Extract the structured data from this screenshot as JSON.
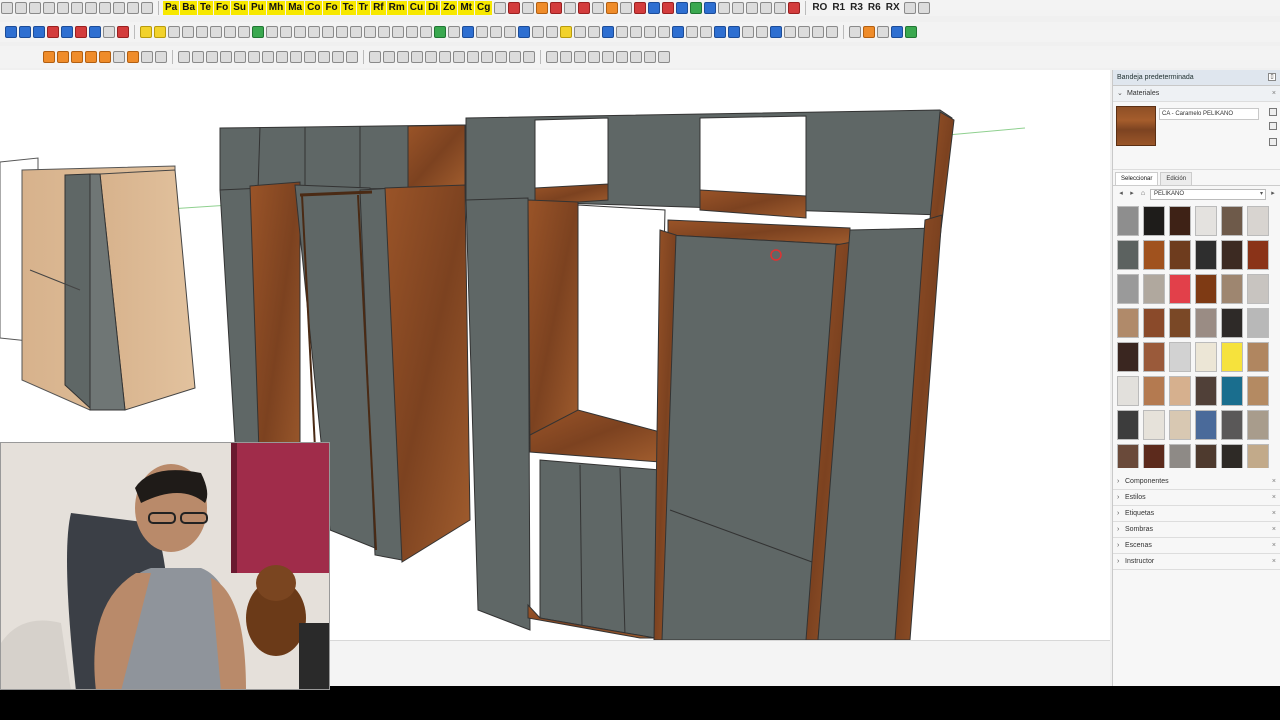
{
  "toolbar": {
    "letter_buttons_left": [
      "Pa",
      "Ba",
      "Te",
      "Fo",
      "Su",
      "Pu",
      "Mh",
      "Ma",
      "Co",
      "Fo",
      "Tc",
      "Tr",
      "Rf",
      "Rm",
      "Cu",
      "Di",
      "Zo",
      "Mt",
      "Cg"
    ],
    "letter_buttons_right": [
      "RO",
      "R1",
      "R3",
      "R6",
      "RX"
    ]
  },
  "tray": {
    "title": "Bandeja predeterminada",
    "materials": {
      "header": "Materiales",
      "current_material": "CA - Caramelo PELIKANO",
      "tabs": [
        "Seleccionar",
        "Edición"
      ],
      "library": "PELIKANO",
      "swatches": [
        "#8e8e8e",
        "#1e1c1a",
        "#3e2216",
        "#e4e2df",
        "#6e5a4a",
        "#d8d4d0",
        "#5c6260",
        "#a0521e",
        "#6e3c1e",
        "#2e2e2e",
        "#3c2a22",
        "#8a3318",
        "#9a9a9a",
        "#b0a89e",
        "#e2404a",
        "#7e3a14",
        "#9e8670",
        "#c8c4c0",
        "#b08a6a",
        "#8a4a2a",
        "#7a4826",
        "#9a8c84",
        "#2e2a28",
        "#b8b8b8",
        "#3a2620",
        "#9a5a3a",
        "#d2d2d2",
        "#ece6d6",
        "#f6e23c",
        "#b08660",
        "#e2e0dc",
        "#b47a50",
        "#d6b08e",
        "#504038",
        "#1a6e8e",
        "#b48a62",
        "#3c3c3c",
        "#e6e2da",
        "#d8c8b2",
        "#4a6a9a",
        "#5a5858",
        "#a89c8c",
        "#6a4a3a",
        "#5c2a1c",
        "#8e8a86",
        "#4e3a2e",
        "#2e2a26",
        "#c2aa8a"
      ]
    },
    "sections": [
      "Componentes",
      "Estilos",
      "Etiquetas",
      "Sombras",
      "Escenas",
      "Instructor"
    ]
  },
  "colors": {
    "grey_panel": "#5f6766",
    "wood": "#8b4c22"
  }
}
